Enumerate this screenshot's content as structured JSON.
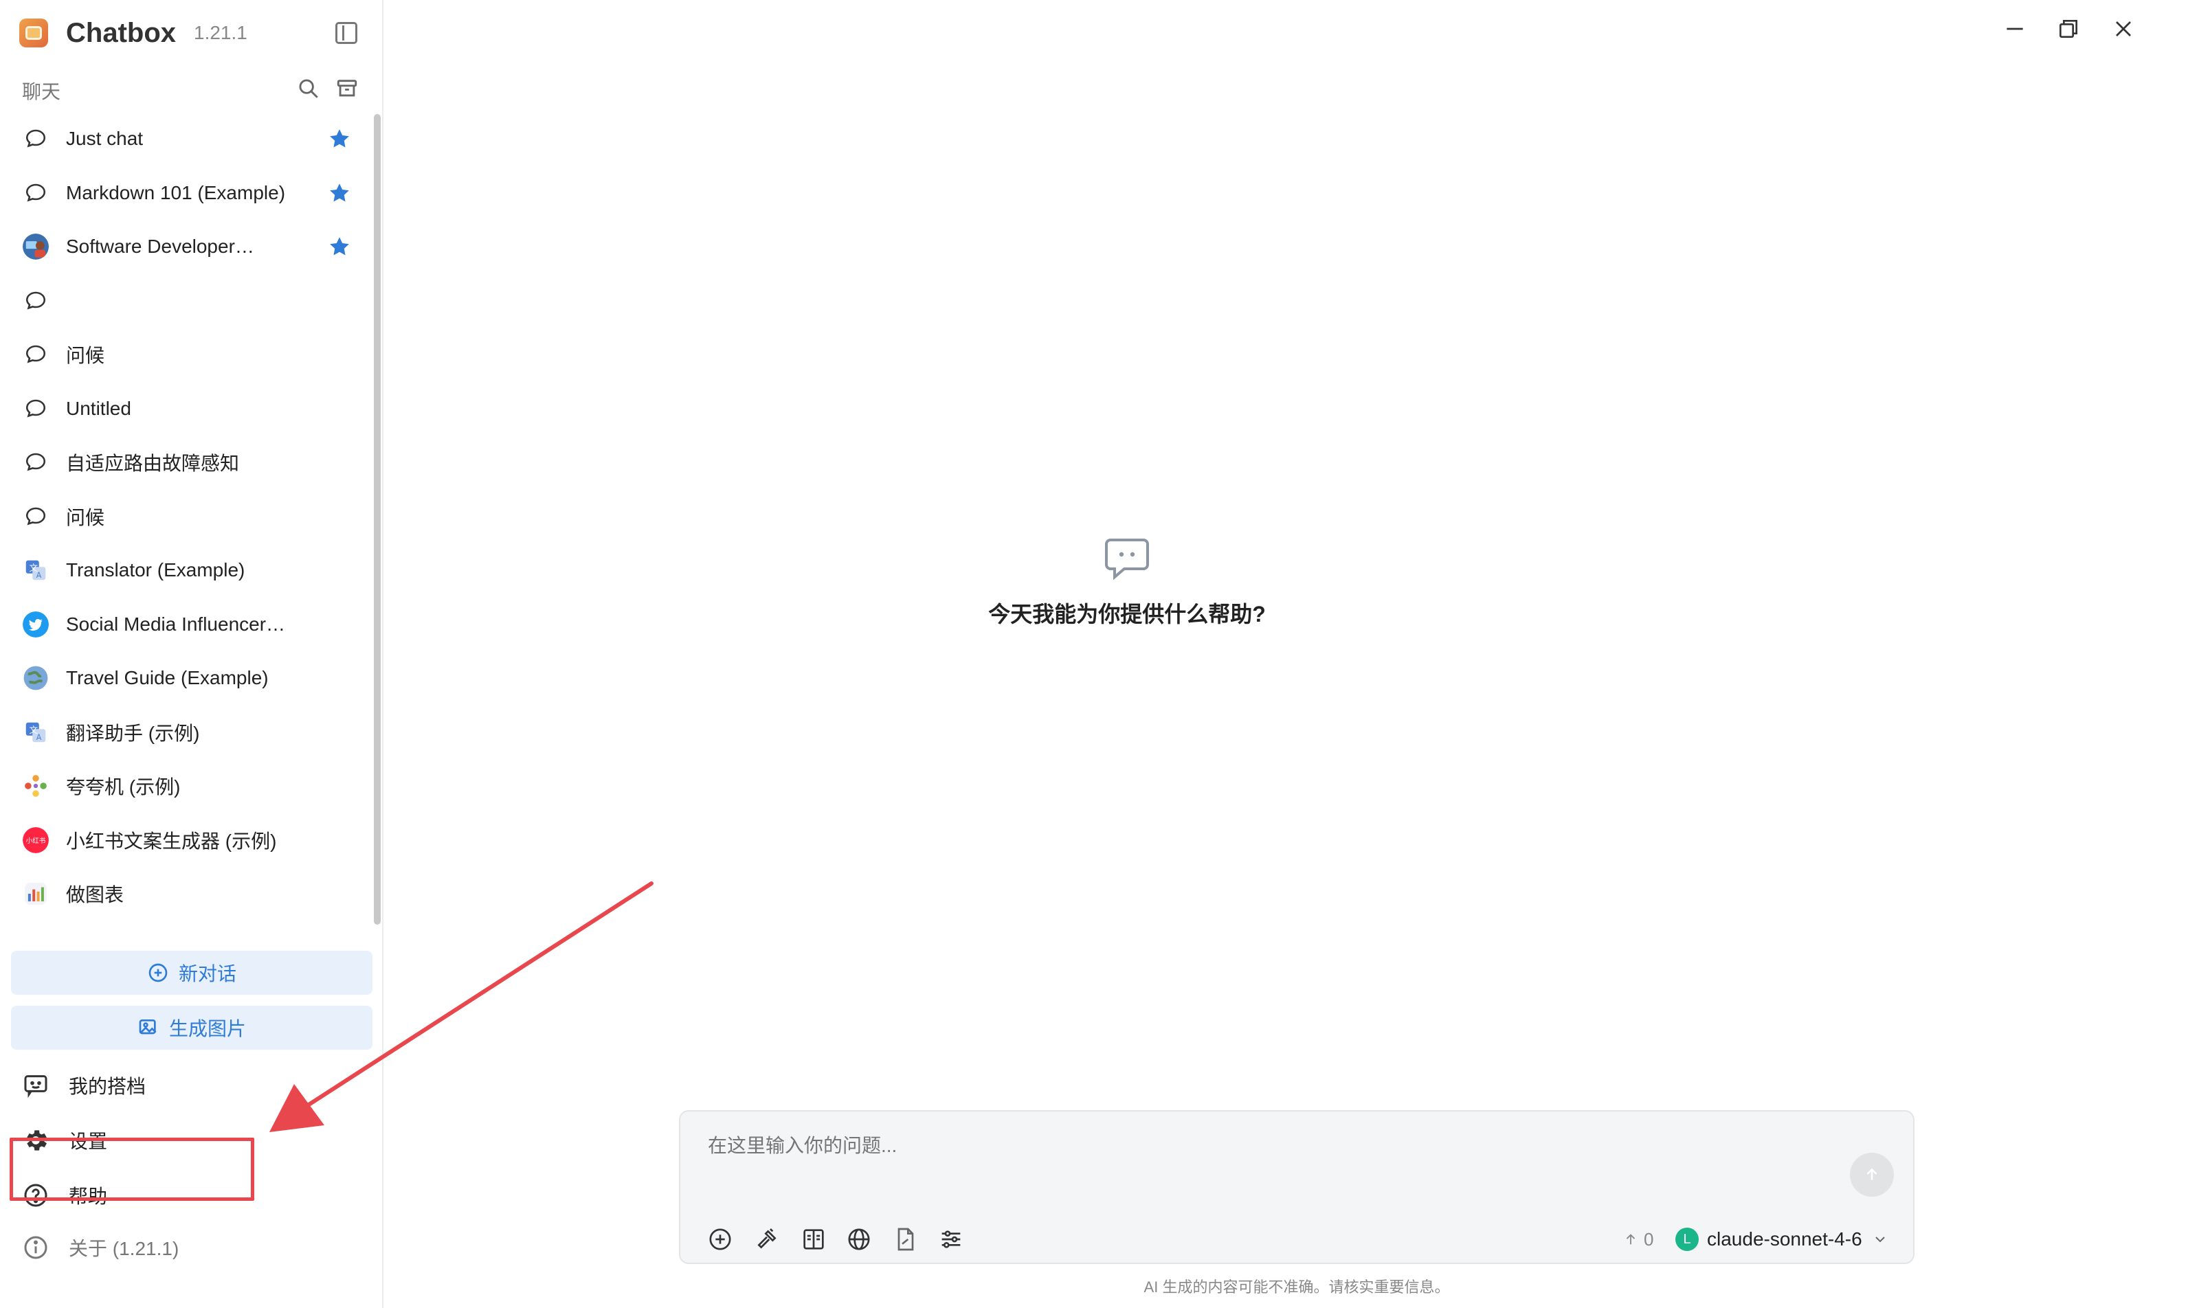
{
  "app": {
    "name": "Chatbox",
    "version": "1.21.1"
  },
  "sidebar": {
    "section_label": "聊天",
    "sessions": [
      {
        "label": "Just chat",
        "icon": "chat-bubble-icon",
        "starred": true
      },
      {
        "label": "Markdown 101 (Example)",
        "icon": "chat-bubble-icon",
        "starred": true
      },
      {
        "label": "Software Developer…",
        "icon": "developer-avatar-icon",
        "starred": true
      },
      {
        "label": "",
        "icon": "chat-bubble-icon",
        "starred": false
      },
      {
        "label": "问候",
        "icon": "chat-bubble-icon",
        "starred": false
      },
      {
        "label": "Untitled",
        "icon": "chat-bubble-icon",
        "starred": false
      },
      {
        "label": "自适应路由故障感知",
        "icon": "chat-bubble-icon",
        "starred": false
      },
      {
        "label": "问候",
        "icon": "chat-bubble-icon",
        "starred": false
      },
      {
        "label": "Translator (Example)",
        "icon": "translator-avatar-icon",
        "starred": false
      },
      {
        "label": "Social Media Influencer…",
        "icon": "twitter-avatar-icon",
        "starred": false
      },
      {
        "label": "Travel Guide (Example)",
        "icon": "globe-avatar-icon",
        "starred": false
      },
      {
        "label": "翻译助手 (示例)",
        "icon": "translator-avatar-icon",
        "starred": false
      },
      {
        "label": "夸夸机 (示例)",
        "icon": "praise-avatar-icon",
        "starred": false
      },
      {
        "label": "小红书文案生成器 (示例)",
        "icon": "xiaohongshu-avatar-icon",
        "starred": false
      },
      {
        "label": "做图表",
        "icon": "chart-avatar-icon",
        "starred": false
      }
    ],
    "new_chat_label": "新对话",
    "generate_image_label": "生成图片",
    "nav": {
      "my_partners": "我的搭档",
      "settings": "设置",
      "help": "帮助",
      "about": "关于 (1.21.1)"
    },
    "avatar_badges": {
      "xiaohongshu": "小红书"
    }
  },
  "main": {
    "empty_title": "今天我能为你提供什么帮助?",
    "composer": {
      "placeholder": "在这里输入你的问题...",
      "context_count": "0",
      "model_badge": "L",
      "model_name": "claude-sonnet-4-6"
    },
    "disclaimer": "AI 生成的内容可能不准确。请核实重要信息。"
  },
  "colors": {
    "accent": "#2f7bd8",
    "star": "#2f7bd8",
    "annotation": "#e8484d",
    "model_dot": "#1bb58a"
  }
}
